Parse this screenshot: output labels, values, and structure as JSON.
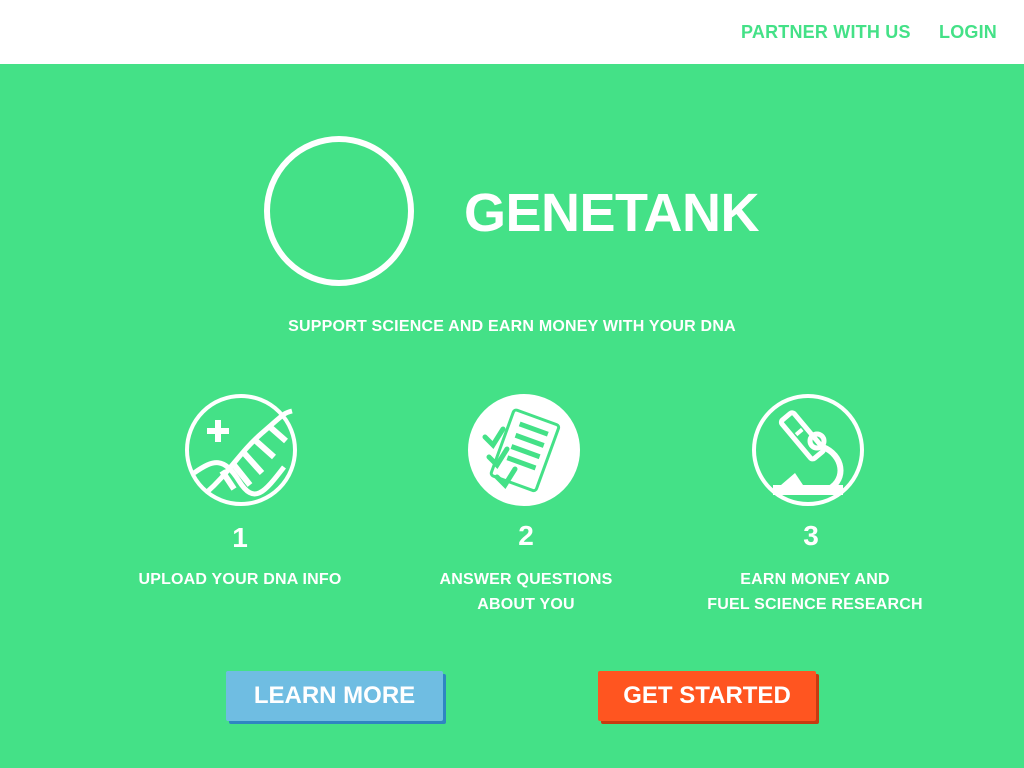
{
  "nav": {
    "partner_label": "PARTNER WITH US",
    "login_label": "LOGIN"
  },
  "hero": {
    "brand": "GENETANK",
    "tagline": "SUPPORT SCIENCE AND EARN MONEY WITH YOUR DNA"
  },
  "steps": [
    {
      "number": "1",
      "label_line1": "UPLOAD YOUR DNA INFO",
      "label_line2": "",
      "icon": "dna-upload-icon"
    },
    {
      "number": "2",
      "label_line1": "ANSWER QUESTIONS",
      "label_line2": "ABOUT YOU",
      "icon": "questionnaire-icon"
    },
    {
      "number": "3",
      "label_line1": "EARN MONEY AND",
      "label_line2": "FUEL SCIENCE RESEARCH",
      "icon": "microscope-icon"
    }
  ],
  "buttons": {
    "learn_more": "LEARN MORE",
    "get_started": "GET STARTED"
  },
  "colors": {
    "brand_green": "#44e187",
    "learn_blue": "#6fbde2",
    "start_orange": "#ff5520",
    "white": "#ffffff"
  }
}
